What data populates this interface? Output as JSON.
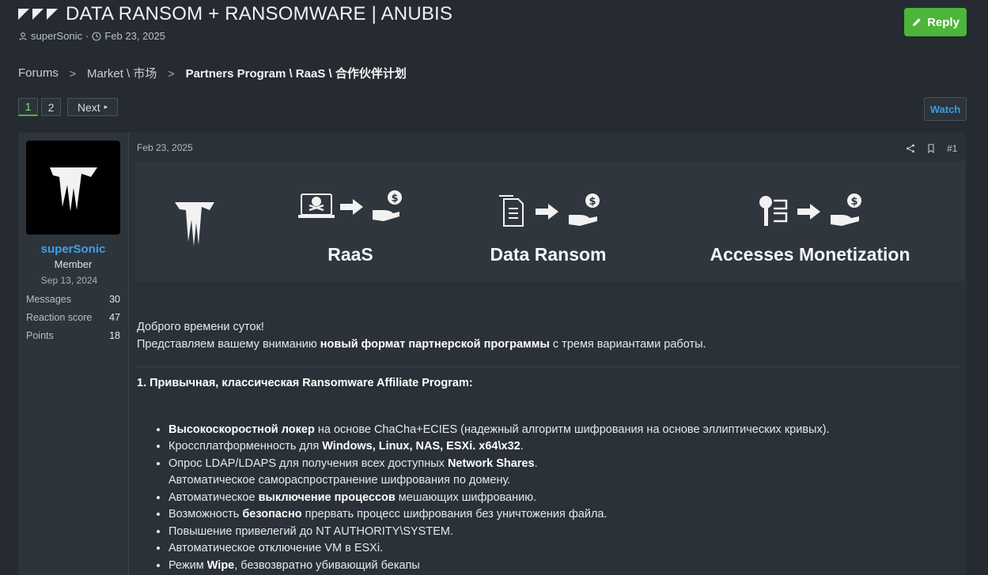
{
  "thread": {
    "title": "DATA RANSOM + RANSOMWARE | ANUBIS",
    "author": "superSonic",
    "date": "Feb 23, 2025",
    "reply_label": "Reply"
  },
  "breadcrumb": [
    "Forums",
    "Market \\ 市场",
    "Partners Program \\ RaaS \\ 合作伙伴计划"
  ],
  "pager": {
    "pages": [
      "1",
      "2"
    ],
    "next_label": "Next",
    "current": "1"
  },
  "watch_label": "Watch",
  "user": {
    "name": "superSonic",
    "role": "Member",
    "joined": "Sep 13, 2024",
    "stats": [
      {
        "label": "Messages",
        "value": "30"
      },
      {
        "label": "Reaction score",
        "value": "47"
      },
      {
        "label": "Points",
        "value": "18"
      }
    ]
  },
  "post": {
    "date": "Feb 23, 2025",
    "number": "#1",
    "banner": {
      "items": [
        "RaaS",
        "Data Ransom",
        "Accesses Monetization"
      ]
    },
    "greeting": "Доброго времени суток!",
    "intro_before": "Представляем вашему вниманию ",
    "intro_bold": "новый формат партнерской программы",
    "intro_after": " с тремя вариантами работы.",
    "section_1_title": "1. Привычная, классическая Ransomware Affiliate Program:",
    "features": [
      {
        "bold": "Высокоскоростной локер",
        "text": " на основе ChaCha+ECIES (надежный алгоритм шифрования на основе эллиптических кривых)."
      },
      {
        "pre": "Кроссплатформенность для ",
        "bold": "Windows, Linux, NAS, ESXi. x64\\x32",
        "text": "."
      },
      {
        "pre": "Опрос LDAP/LDAPS для получения всех доступных ",
        "bold": "Network Shares",
        "text": ".",
        "line2": "Автоматическое самораспространение шифрования по домену."
      },
      {
        "pre": "Автоматическое ",
        "bold": "выключение процессов",
        "text": " мешающих шифрованию."
      },
      {
        "pre": "Возможность ",
        "bold": "безопасно",
        "text": " прервать процесс шифрования без уничтожения файла."
      },
      {
        "pre": "Повышение привелегий до NT AUTHORITY\\SYSTEM.",
        "bold": "",
        "text": ""
      },
      {
        "pre": "Автоматическое отключение VM в ESXi.",
        "bold": "",
        "text": ""
      },
      {
        "pre": "Режим ",
        "bold": "Wipe",
        "text": ", безвозвратно убивающий бекапы"
      }
    ]
  }
}
